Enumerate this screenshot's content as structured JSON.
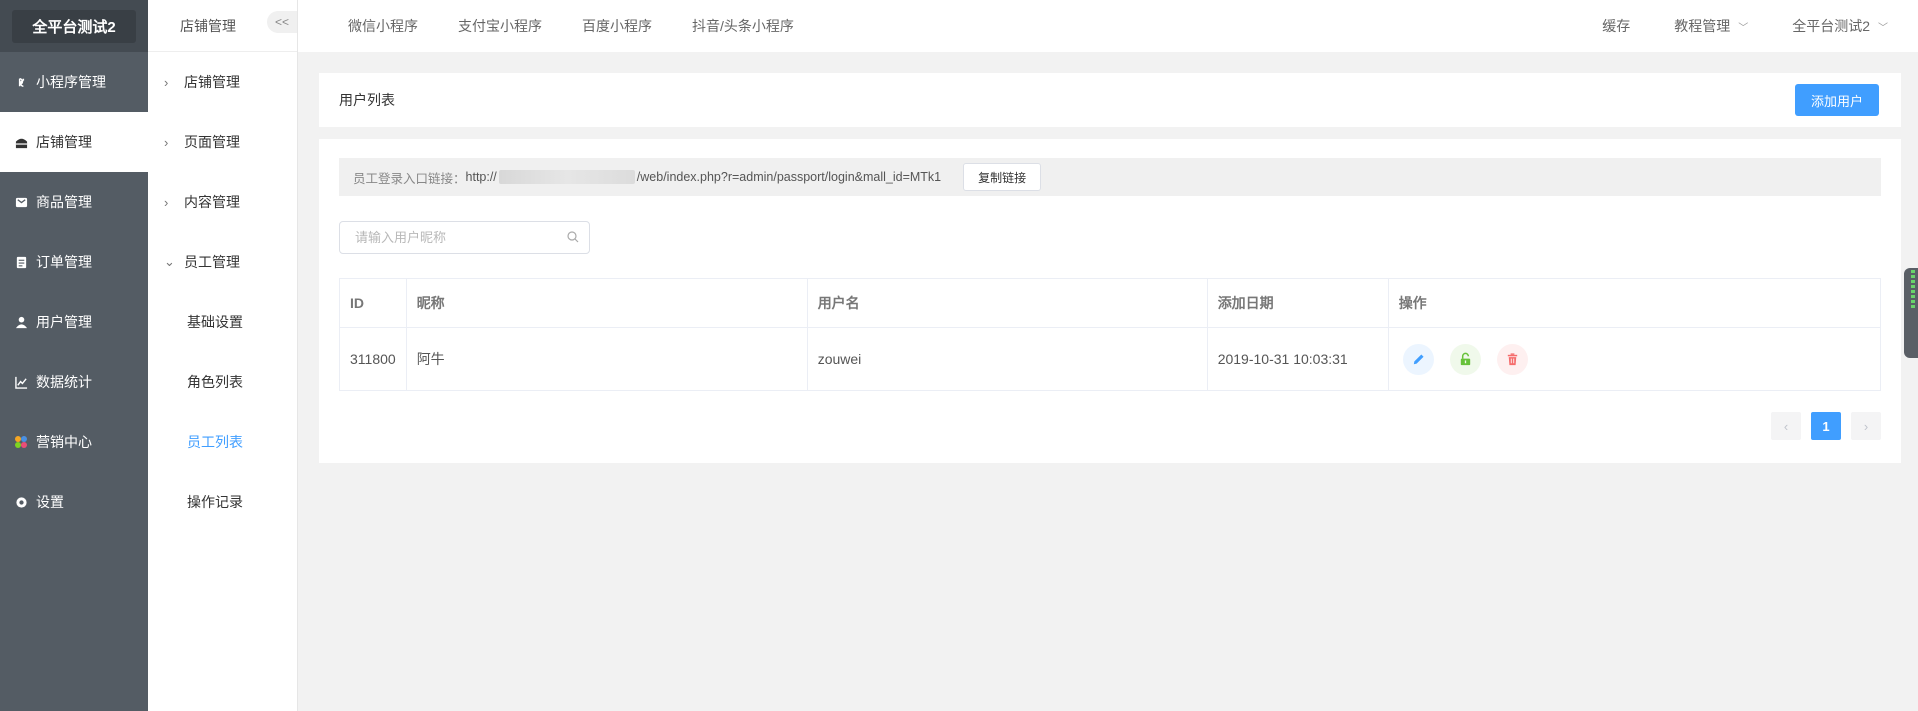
{
  "brand": "全平台测试2",
  "nav": [
    {
      "label": "小程序管理",
      "icon": "mini-program-icon"
    },
    {
      "label": "店铺管理",
      "icon": "shop-icon",
      "active": true
    },
    {
      "label": "商品管理",
      "icon": "goods-icon"
    },
    {
      "label": "订单管理",
      "icon": "order-icon"
    },
    {
      "label": "用户管理",
      "icon": "user-icon"
    },
    {
      "label": "数据统计",
      "icon": "chart-icon"
    },
    {
      "label": "营销中心",
      "icon": "marketing-icon"
    },
    {
      "label": "设置",
      "icon": "settings-icon"
    }
  ],
  "subnav": {
    "title": "店铺管理",
    "collapse": "<<",
    "groups": [
      {
        "label": "店铺管理"
      },
      {
        "label": "页面管理"
      },
      {
        "label": "内容管理"
      },
      {
        "label": "员工管理",
        "expanded": true
      }
    ],
    "children": [
      "基础设置",
      "角色列表",
      "员工列表",
      "操作记录"
    ],
    "active_child": "员工列表"
  },
  "topbar": {
    "tabs": [
      "微信小程序",
      "支付宝小程序",
      "百度小程序",
      "抖音/头条小程序"
    ],
    "right": [
      "缓存",
      "教程管理",
      "全平台测试2"
    ]
  },
  "page": {
    "title": "用户列表",
    "add_button": "添加用户",
    "link_label": "员工登录入口链接：",
    "link_prefix": "http://",
    "link_suffix": "/web/index.php?r=admin/passport/login&mall_id=MTk1",
    "copy_button": "复制链接",
    "search_placeholder": "请输入用户昵称"
  },
  "table": {
    "headers": [
      "ID",
      "昵称",
      "用户名",
      "添加日期",
      "操作"
    ],
    "rows": [
      {
        "id": "311800",
        "nickname": "阿牛",
        "username": "zouwei",
        "date": "2019-10-31 10:03:31"
      }
    ]
  },
  "pagination": {
    "prev": "‹",
    "current": "1",
    "next": "›"
  },
  "colors": {
    "primary": "#409eff",
    "sidebar": "#545c64",
    "success": "#67c23a",
    "danger": "#f56c6c"
  }
}
